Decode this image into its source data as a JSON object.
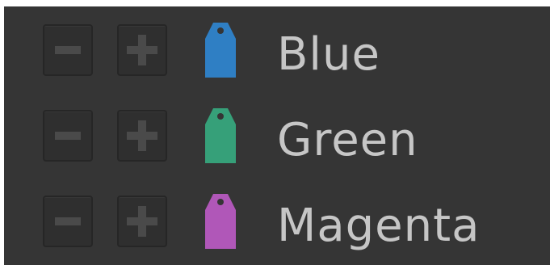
{
  "color_tags": [
    {
      "label": "Blue",
      "color": "#2f7fc4",
      "icon": "tag-icon",
      "remove_icon": "minus-icon",
      "add_icon": "plus-icon"
    },
    {
      "label": "Green",
      "color": "#36a079",
      "icon": "tag-icon",
      "remove_icon": "minus-icon",
      "add_icon": "plus-icon"
    },
    {
      "label": "Magenta",
      "color": "#b057b8",
      "icon": "tag-icon",
      "remove_icon": "minus-icon",
      "add_icon": "plus-icon"
    }
  ]
}
